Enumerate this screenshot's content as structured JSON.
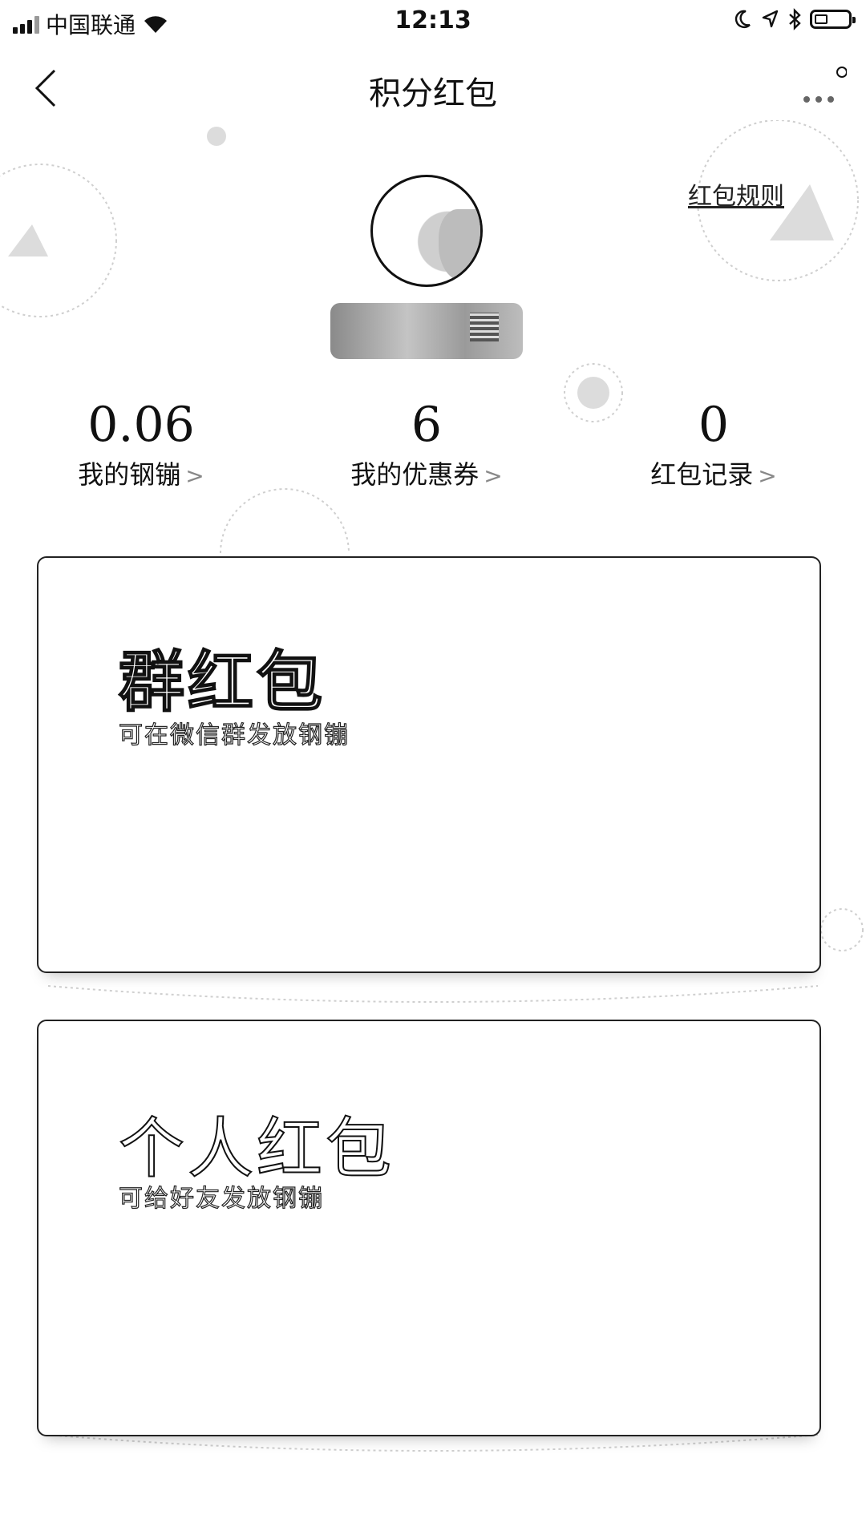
{
  "status_bar": {
    "carrier": "中国联通",
    "time": "12:13"
  },
  "nav": {
    "title": "积分红包"
  },
  "header": {
    "rules_label": "红包规则"
  },
  "stats": [
    {
      "value": "0.06",
      "label": "我的钢镚"
    },
    {
      "value": "6",
      "label": "我的优惠券"
    },
    {
      "value": "0",
      "label": "红包记录"
    }
  ],
  "cards": {
    "group": {
      "title": "群红包",
      "description": "可在微信群发放钢镚"
    },
    "personal": {
      "title": "个人红包",
      "description": "可给好友发放钢镚"
    }
  },
  "icons": {
    "back": "chevron-left-icon",
    "more": "more-dots-icon",
    "stat_arrow": "chevron-right-icon"
  }
}
